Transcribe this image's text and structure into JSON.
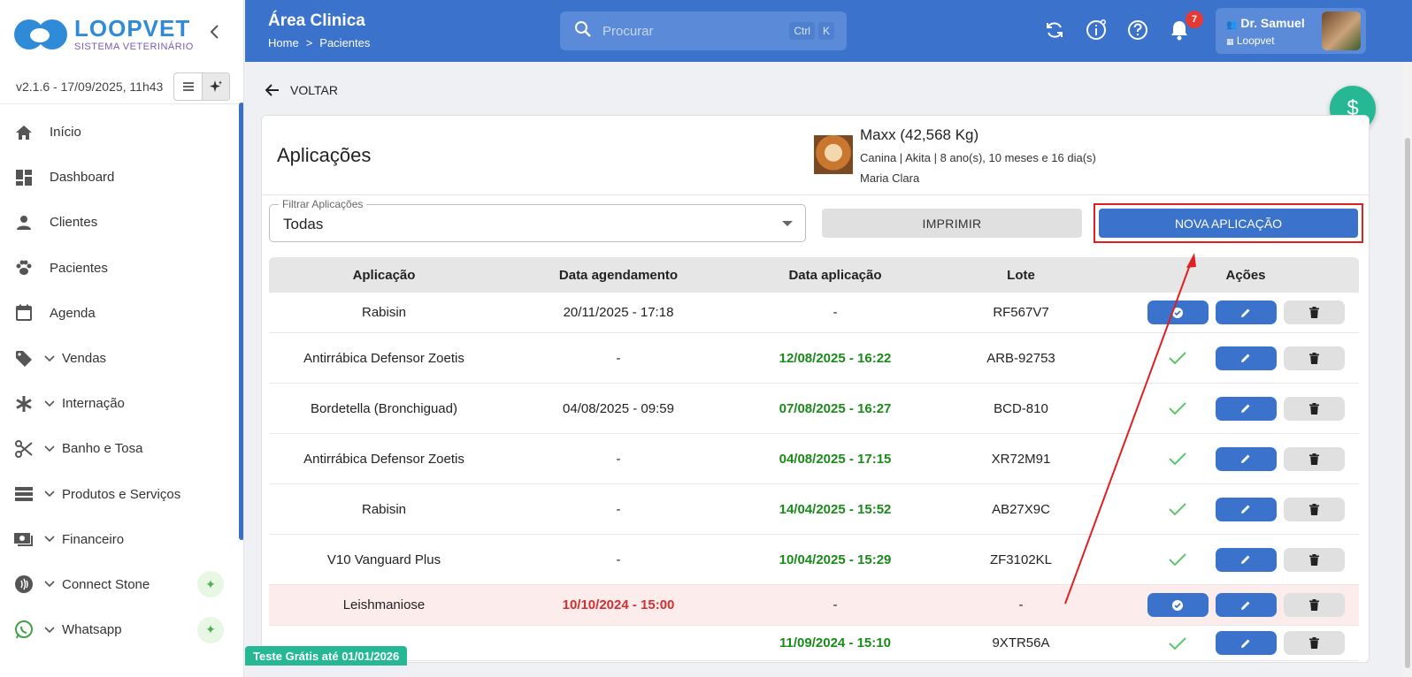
{
  "sidebar": {
    "logo_title": "LOOPVET",
    "logo_subtitle": "SISTEMA VETERINÁRIO",
    "version": "v2.1.6 - 17/09/2025, 11h43",
    "items": [
      {
        "label": "Início",
        "icon": "home-icon"
      },
      {
        "label": "Dashboard",
        "icon": "dashboard-icon"
      },
      {
        "label": "Clientes",
        "icon": "person-icon"
      },
      {
        "label": "Pacientes",
        "icon": "paw-icon"
      },
      {
        "label": "Agenda",
        "icon": "calendar-icon"
      },
      {
        "label": "Vendas",
        "icon": "tag-icon"
      },
      {
        "label": "Internação",
        "icon": "asterisk-icon"
      },
      {
        "label": "Banho e Tosa",
        "icon": "scissors-icon"
      },
      {
        "label": "Produtos e Serviços",
        "icon": "list-icon"
      },
      {
        "label": "Financeiro",
        "icon": "money-icon"
      },
      {
        "label": "Connect Stone",
        "icon": "nfc-icon"
      },
      {
        "label": "Whatsapp",
        "icon": "whatsapp-icon"
      }
    ]
  },
  "header": {
    "title": "Área Clinica",
    "breadcrumb_home": "Home",
    "breadcrumb_sep": ">",
    "breadcrumb_current": "Pacientes",
    "search_placeholder": "Procurar",
    "kbd_ctrl": "Ctrl",
    "kbd_k": "K",
    "notification_count": "7",
    "user_name": "Dr. Samuel",
    "user_org": "Loopvet"
  },
  "main": {
    "back_label": "VOLTAR",
    "money_icon": "$",
    "trial_badge": "Teste Grátis até 01/01/2026",
    "card_title": "Aplicações",
    "pet": {
      "name": "Maxx (42,568 Kg)",
      "info": "Canina | Akita | 8 ano(s), 10 meses e 16 dia(s)",
      "owner": "Maria Clara"
    },
    "filter_label": "Filtrar Aplicações",
    "filter_value": "Todas",
    "print_label": "IMPRIMIR",
    "new_label": "NOVA APLICAÇÃO"
  },
  "table": {
    "columns": [
      "Aplicação",
      "Data agendamento",
      "Data aplicação",
      "Lote",
      "Ações"
    ],
    "rows": [
      {
        "name": "Rabisin",
        "scheduled": "20/11/2025 - 17:18",
        "applied": "-",
        "lot": "RF567V7",
        "status": "pending"
      },
      {
        "name": "Antirrábica Defensor Zoetis",
        "scheduled": "-",
        "applied": "12/08/2025 - 16:22",
        "lot": "ARB-92753",
        "status": "done"
      },
      {
        "name": "Bordetella (Bronchiguad)",
        "scheduled": "04/08/2025 - 09:59",
        "applied": "07/08/2025 - 16:27",
        "lot": "BCD-810",
        "status": "done"
      },
      {
        "name": "Antirrábica Defensor Zoetis",
        "scheduled": "-",
        "applied": "04/08/2025 - 17:15",
        "lot": "XR72M91",
        "status": "done"
      },
      {
        "name": "Rabisin",
        "scheduled": "-",
        "applied": "14/04/2025 - 15:52",
        "lot": "AB27X9C",
        "status": "done"
      },
      {
        "name": "V10 Vanguard Plus",
        "scheduled": "-",
        "applied": "10/04/2025 - 15:29",
        "lot": "ZF3102KL",
        "status": "done"
      },
      {
        "name": "Leishmaniose",
        "scheduled": "10/10/2024 - 15:00",
        "applied": "-",
        "lot": "-",
        "status": "overdue"
      },
      {
        "name": "",
        "scheduled": "",
        "applied": "11/09/2024 - 15:10",
        "lot": "9XTR56A",
        "status": "done"
      }
    ]
  },
  "colors": {
    "primary": "#3a72cc",
    "applied_green": "#1a8a1a",
    "overdue_red": "#d32f2f",
    "accent_teal": "#26b894",
    "annotation_red": "#e02020"
  }
}
